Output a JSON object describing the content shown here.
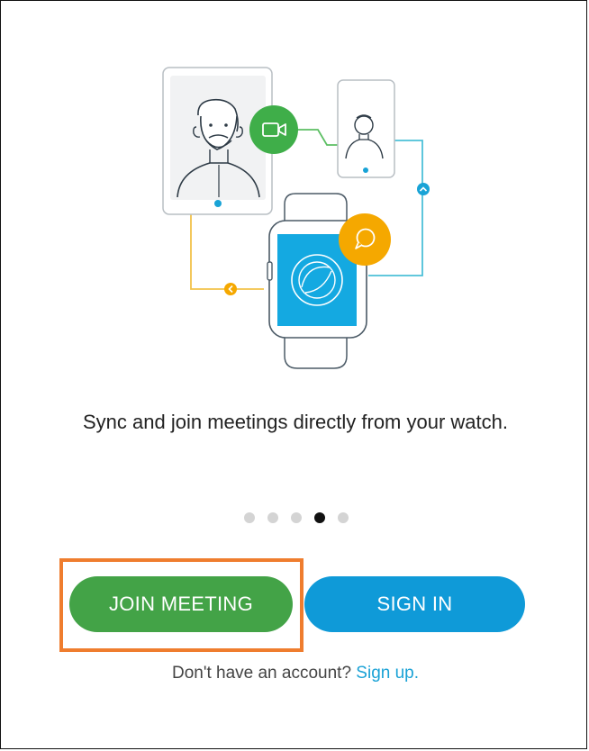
{
  "onboarding": {
    "tagline": "Sync and join meetings directly from your watch.",
    "page_indicator": {
      "total": 5,
      "active_index": 3
    }
  },
  "actions": {
    "join_label": "JOIN MEETING",
    "sign_in_label": "SIGN IN"
  },
  "signup": {
    "prompt": "Don't have an account?",
    "link": "Sign up."
  },
  "colors": {
    "join_button": "#43a347",
    "sign_in_button": "#0f9ad8",
    "highlight_border": "#ef7d2e",
    "link": "#1aa2d6",
    "video_badge": "#3fae49",
    "chat_badge": "#f5a800",
    "watch_screen": "#14a9e1"
  },
  "icons": {
    "video_badge": "video-camera-icon",
    "chat_badge": "chat-bubble-icon",
    "watch_logo": "webex-logo-icon"
  }
}
